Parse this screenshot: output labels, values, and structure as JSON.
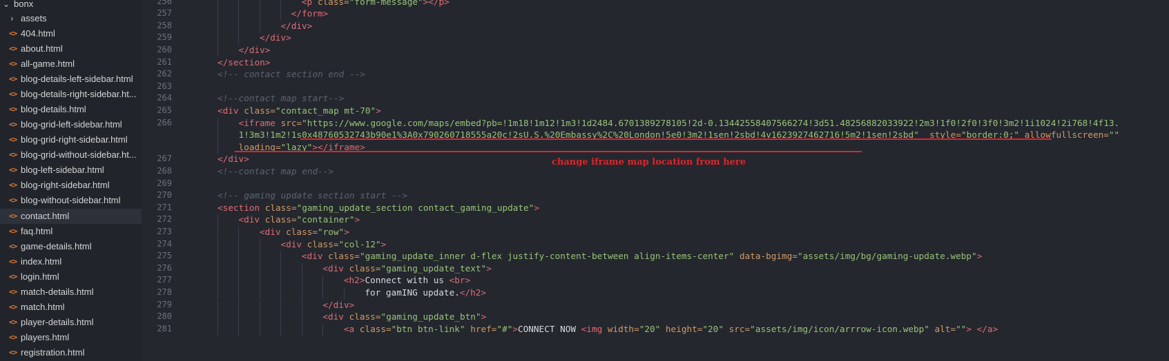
{
  "sidebar": {
    "folder": "bonx",
    "items": [
      {
        "label": "assets",
        "type": "folder"
      },
      {
        "label": "404.html",
        "type": "html"
      },
      {
        "label": "about.html",
        "type": "html"
      },
      {
        "label": "all-game.html",
        "type": "html"
      },
      {
        "label": "blog-details-left-sidebar.html",
        "type": "html"
      },
      {
        "label": "blog-details-right-sidebar.ht...",
        "type": "html"
      },
      {
        "label": "blog-details.html",
        "type": "html"
      },
      {
        "label": "blog-grid-left-sidebar.html",
        "type": "html"
      },
      {
        "label": "blog-grid-right-sidebar.html",
        "type": "html"
      },
      {
        "label": "blog-grid-without-sidebar.ht...",
        "type": "html"
      },
      {
        "label": "blog-left-sidebar.html",
        "type": "html"
      },
      {
        "label": "blog-right-sidebar.html",
        "type": "html"
      },
      {
        "label": "blog-without-sidebar.html",
        "type": "html"
      },
      {
        "label": "contact.html",
        "type": "html",
        "active": true
      },
      {
        "label": "faq.html",
        "type": "html"
      },
      {
        "label": "game-details.html",
        "type": "html"
      },
      {
        "label": "index.html",
        "type": "html"
      },
      {
        "label": "login.html",
        "type": "html"
      },
      {
        "label": "match-details.html",
        "type": "html"
      },
      {
        "label": "match.html",
        "type": "html"
      },
      {
        "label": "player-details.html",
        "type": "html"
      },
      {
        "label": "players.html",
        "type": "html"
      },
      {
        "label": "registration.html",
        "type": "html"
      }
    ]
  },
  "editor": {
    "lines": [
      {
        "n": "256",
        "indent": 16,
        "tokens": [
          [
            "tag",
            "<p "
          ],
          [
            "attr",
            "class="
          ],
          [
            "str",
            "\"form-message\""
          ],
          [
            "tag",
            "></p>"
          ]
        ]
      },
      {
        "n": "257",
        "indent": 14,
        "tokens": [
          [
            "tag",
            "</form>"
          ]
        ]
      },
      {
        "n": "258",
        "indent": 12,
        "tokens": [
          [
            "tag",
            "</div>"
          ]
        ]
      },
      {
        "n": "259",
        "indent": 8,
        "tokens": [
          [
            "tag",
            "</div>"
          ]
        ]
      },
      {
        "n": "260",
        "indent": 4,
        "tokens": [
          [
            "tag",
            "</div>"
          ]
        ]
      },
      {
        "n": "261",
        "indent": 0,
        "tokens": [
          [
            "tag",
            "</section>"
          ]
        ]
      },
      {
        "n": "262",
        "indent": 0,
        "tokens": [
          [
            "cmt",
            "<!-- contact section end -->"
          ]
        ]
      },
      {
        "n": "263",
        "indent": 0,
        "tokens": []
      },
      {
        "n": "264",
        "indent": 0,
        "tokens": [
          [
            "cmt",
            "<!--contact map start-->"
          ]
        ]
      },
      {
        "n": "265",
        "indent": 0,
        "tokens": [
          [
            "tag",
            "<div "
          ],
          [
            "attr",
            "class="
          ],
          [
            "str",
            "\"contact_map mt-70\""
          ],
          [
            "tag",
            ">"
          ]
        ]
      },
      {
        "n": "266",
        "indent": 4,
        "tokens": [
          [
            "tag",
            "<iframe "
          ],
          [
            "attr",
            "src="
          ],
          [
            "str",
            "\"https://www.google.com/maps/embed?pb=!1m18!1m12!1m3!1d2484.6701389278105!2d-0.13442558407566274!3d51.48256882033922!2m3!1f0!2f0!3f0!3m2!1i1024!2i768!4f13."
          ]
        ]
      },
      {
        "n": "",
        "indent": 4,
        "tokens": [
          [
            "str",
            "1!3m3!1m2!1s0x48760532743b90e1%3A0x790260718555a20c!2sU.S.%20Embassy%2C%20London!5e0!3m2!1sen!2sbd!4v1623927462716!5m2!1sen!2sbd\""
          ],
          [
            "txt",
            "  "
          ],
          [
            "attr",
            "style="
          ],
          [
            "str",
            "\"border:0;\""
          ],
          [
            "txt",
            " "
          ],
          [
            "attr",
            "allowfullscreen="
          ],
          [
            "str",
            "\"\""
          ]
        ]
      },
      {
        "n": "",
        "indent": 4,
        "tokens": [
          [
            "attr",
            "loading="
          ],
          [
            "str",
            "\"lazy\""
          ],
          [
            "tag",
            "></iframe>"
          ]
        ]
      },
      {
        "n": "267",
        "indent": 0,
        "tokens": [
          [
            "tag",
            "</div>"
          ]
        ]
      },
      {
        "n": "268",
        "indent": 0,
        "tokens": [
          [
            "cmt",
            "<!--contact map end-->"
          ]
        ]
      },
      {
        "n": "269",
        "indent": 0,
        "tokens": []
      },
      {
        "n": "270",
        "indent": 0,
        "tokens": [
          [
            "cmt",
            "<!-- gaming update section start -->"
          ]
        ]
      },
      {
        "n": "271",
        "indent": 0,
        "tokens": [
          [
            "tag",
            "<section "
          ],
          [
            "attr",
            "class="
          ],
          [
            "str",
            "\"gaming_update_section contact_gaming_update\""
          ],
          [
            "tag",
            ">"
          ]
        ]
      },
      {
        "n": "272",
        "indent": 4,
        "tokens": [
          [
            "tag",
            "<div "
          ],
          [
            "attr",
            "class="
          ],
          [
            "str",
            "\"container\""
          ],
          [
            "tag",
            ">"
          ]
        ]
      },
      {
        "n": "273",
        "indent": 8,
        "tokens": [
          [
            "tag",
            "<div "
          ],
          [
            "attr",
            "class="
          ],
          [
            "str",
            "\"row\""
          ],
          [
            "tag",
            ">"
          ]
        ]
      },
      {
        "n": "274",
        "indent": 12,
        "tokens": [
          [
            "tag",
            "<div "
          ],
          [
            "attr",
            "class="
          ],
          [
            "str",
            "\"col-12\""
          ],
          [
            "tag",
            ">"
          ]
        ]
      },
      {
        "n": "275",
        "indent": 16,
        "tokens": [
          [
            "tag",
            "<div "
          ],
          [
            "attr",
            "class="
          ],
          [
            "str",
            "\"gaming_update_inner d-flex justify-content-between align-items-center\""
          ],
          [
            "txt",
            " "
          ],
          [
            "attr",
            "data-bgimg="
          ],
          [
            "str",
            "\"assets/img/bg/gaming-update.webp\""
          ],
          [
            "tag",
            ">"
          ]
        ]
      },
      {
        "n": "276",
        "indent": 20,
        "tokens": [
          [
            "tag",
            "<div "
          ],
          [
            "attr",
            "class="
          ],
          [
            "str",
            "\"gaming_update_text\""
          ],
          [
            "tag",
            ">"
          ]
        ]
      },
      {
        "n": "277",
        "indent": 24,
        "tokens": [
          [
            "tag",
            "<h2>"
          ],
          [
            "txt",
            "Connect with us "
          ],
          [
            "tag",
            "<br>"
          ]
        ]
      },
      {
        "n": "278",
        "indent": 28,
        "tokens": [
          [
            "txt",
            "for gamING update."
          ],
          [
            "tag",
            "</h2>"
          ]
        ]
      },
      {
        "n": "279",
        "indent": 20,
        "tokens": [
          [
            "tag",
            "</div>"
          ]
        ]
      },
      {
        "n": "280",
        "indent": 20,
        "tokens": [
          [
            "tag",
            "<div "
          ],
          [
            "attr",
            "class="
          ],
          [
            "str",
            "\"gaming_update_btn\""
          ],
          [
            "tag",
            ">"
          ]
        ]
      },
      {
        "n": "281",
        "indent": 24,
        "tokens": [
          [
            "tag",
            "<a "
          ],
          [
            "attr",
            "class="
          ],
          [
            "str",
            "\"btn btn-link\""
          ],
          [
            "txt",
            " "
          ],
          [
            "attr",
            "href="
          ],
          [
            "str",
            "\"#\""
          ],
          [
            "tag",
            ">"
          ],
          [
            "txt",
            "CONNECT NOW "
          ],
          [
            "tag",
            "<img "
          ],
          [
            "attr",
            "width="
          ],
          [
            "str",
            "\"20\""
          ],
          [
            "txt",
            " "
          ],
          [
            "attr",
            "height="
          ],
          [
            "str",
            "\"20\""
          ],
          [
            "txt",
            " "
          ],
          [
            "attr",
            "src="
          ],
          [
            "str",
            "\"assets/img/icon/arrrow-icon.webp\""
          ],
          [
            "txt",
            " "
          ],
          [
            "attr",
            "alt="
          ],
          [
            "str",
            "\"\""
          ],
          [
            "tag",
            "> </a>"
          ]
        ]
      }
    ],
    "annotation": "change iframe map location from here"
  }
}
